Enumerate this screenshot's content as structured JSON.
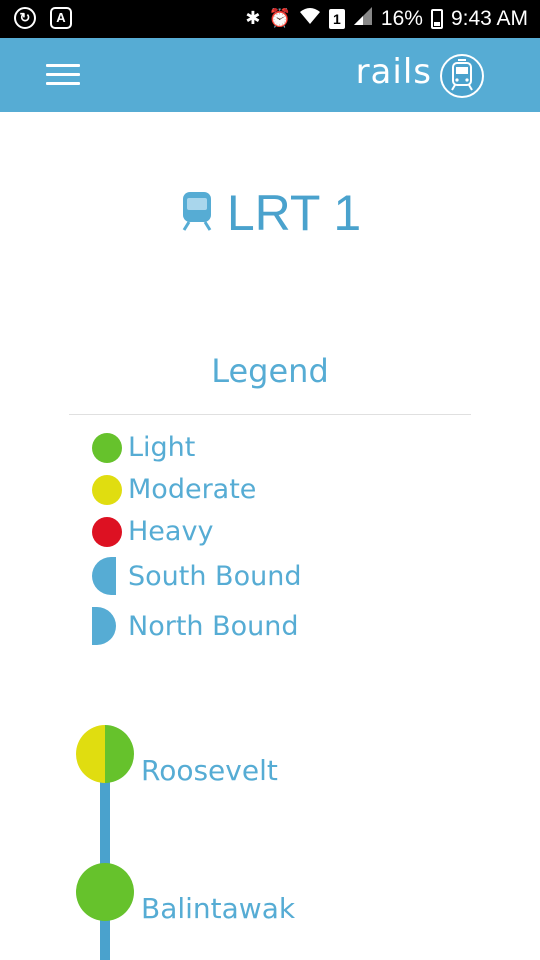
{
  "status_bar": {
    "left_icons": [
      "sync-icon",
      "font-a-icon"
    ],
    "sim_label": "1",
    "battery": "16%",
    "time": "9:43 AM"
  },
  "app_bar": {
    "brand": "rails",
    "menu_icon": "hamburger-menu-icon",
    "logo_icon": "train-logo-icon"
  },
  "line": {
    "title": "LRT 1",
    "icon": "train-icon"
  },
  "legend": {
    "title": "Legend",
    "items": [
      {
        "label": "Light",
        "color": "#66c22c",
        "type": "dot"
      },
      {
        "label": "Moderate",
        "color": "#e0dd10",
        "type": "dot"
      },
      {
        "label": "Heavy",
        "color": "#dd1122",
        "type": "dot"
      },
      {
        "label": "South Bound",
        "color": "#56acd4",
        "type": "half-left"
      },
      {
        "label": "North Bound",
        "color": "#56acd4",
        "type": "half-right"
      }
    ]
  },
  "stations": [
    {
      "name": "Roosevelt",
      "south_bound": "#e0dd10",
      "north_bound": "#66c22c"
    },
    {
      "name": "Balintawak",
      "south_bound": "#66c22c",
      "north_bound": "#66c22c"
    }
  ],
  "colors": {
    "primary": "#56acd4",
    "track": "#4aa2cd"
  }
}
